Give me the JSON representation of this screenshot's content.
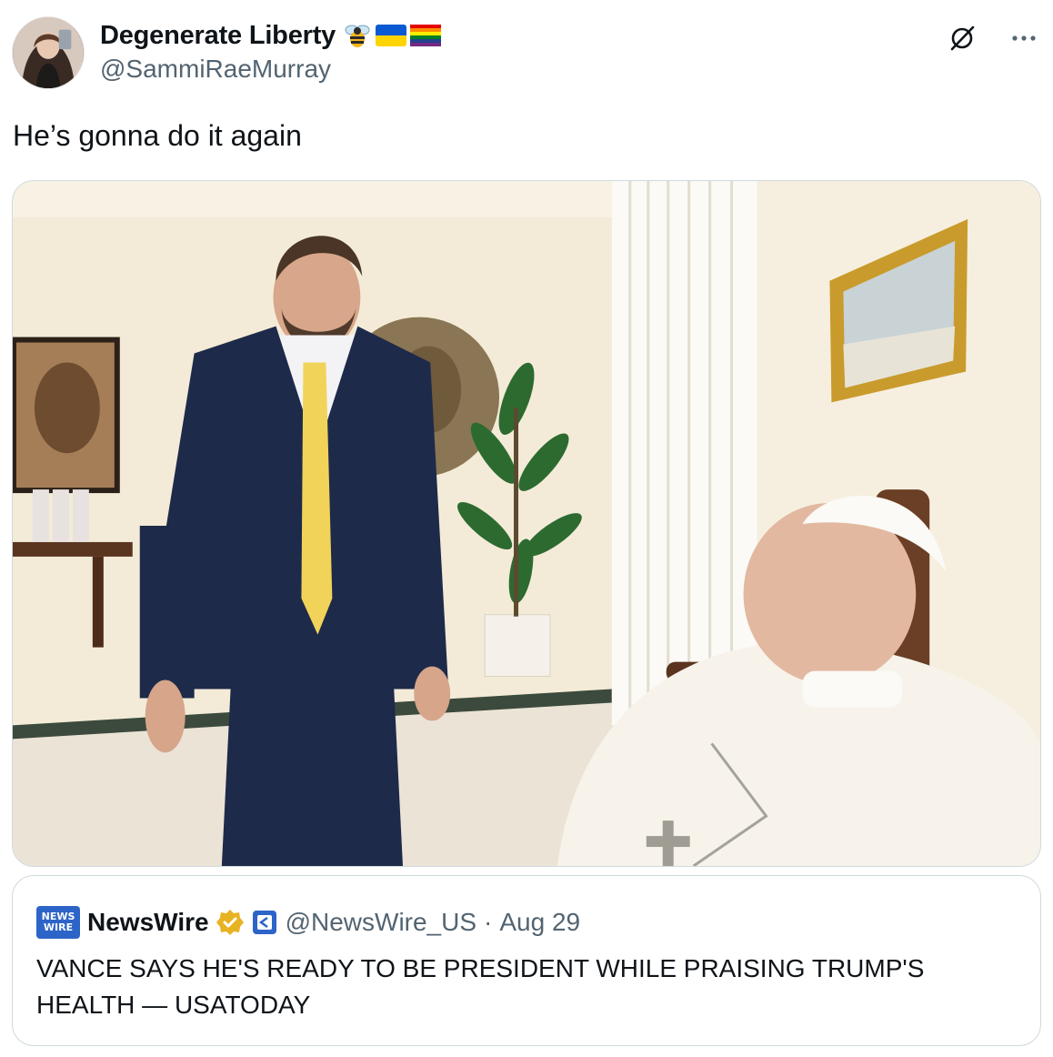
{
  "author": {
    "display_name": "Degenerate Liberty",
    "handle": "@SammiRaeMurray",
    "emojis": [
      "bee-emoji",
      "ukraine-flag-emoji",
      "rainbow-flag-emoji"
    ]
  },
  "post": {
    "text": "He’s gonna do it again"
  },
  "quoted_post": {
    "name": "NewsWire",
    "logo_text_top": "NEWS",
    "logo_text_bottom": "WIRE",
    "handle": "@NewsWire_US",
    "separator": "·",
    "date": "Aug 29",
    "text": "VANCE SAYS HE'S READY TO BE PRESIDENT WHILE PRAISING TRUMP'S HEALTH — USATODAY"
  },
  "colors": {
    "secondary_text": "#536471",
    "border": "#cfd9de",
    "verified_gold": "#e8b323",
    "newswire_blue": "#2d64c8"
  },
  "icons": {
    "grok": "grok-icon",
    "more": "more-icon"
  }
}
